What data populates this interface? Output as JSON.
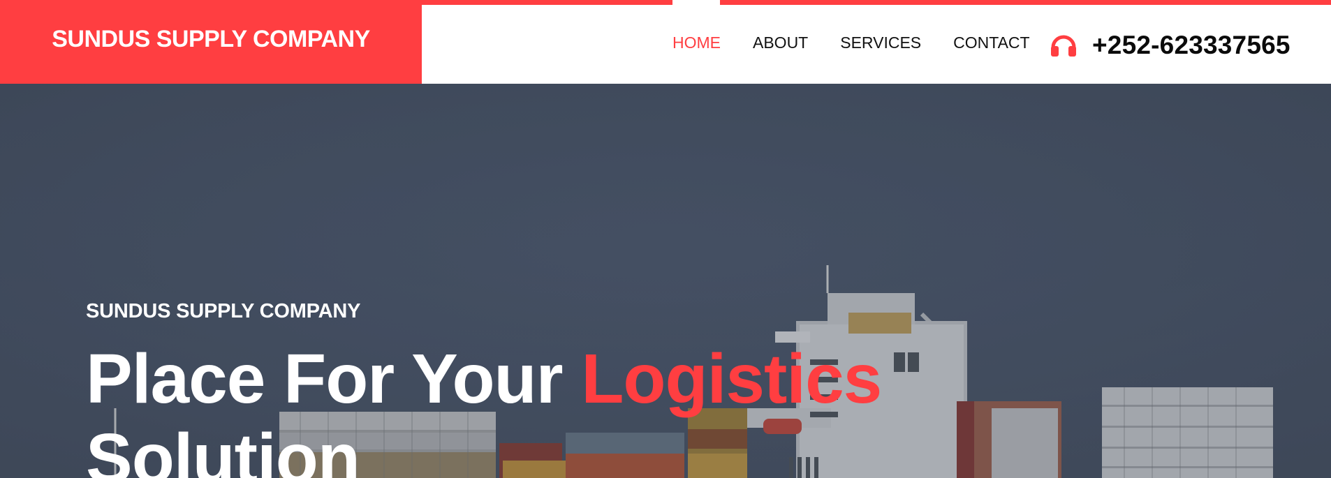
{
  "brand": {
    "name": "SUNDUS SUPPLY COMPANY"
  },
  "nav": {
    "items": [
      {
        "label": "HOME",
        "active": true
      },
      {
        "label": "ABOUT",
        "active": false
      },
      {
        "label": "SERVICES",
        "active": false
      },
      {
        "label": "CONTACT",
        "active": false
      }
    ]
  },
  "contact": {
    "phone": "+252-623337565",
    "icon": "headphones-icon"
  },
  "hero": {
    "subtitle": "SUNDUS SUPPLY COMPANY",
    "title_part1": "Place For Your ",
    "title_accent": "Logistics",
    "title_part2": "Solution",
    "background": "container-ship-photo"
  },
  "colors": {
    "accent": "#ff3e41",
    "text_dark": "#111111",
    "hero_sky": "#4b5669"
  }
}
